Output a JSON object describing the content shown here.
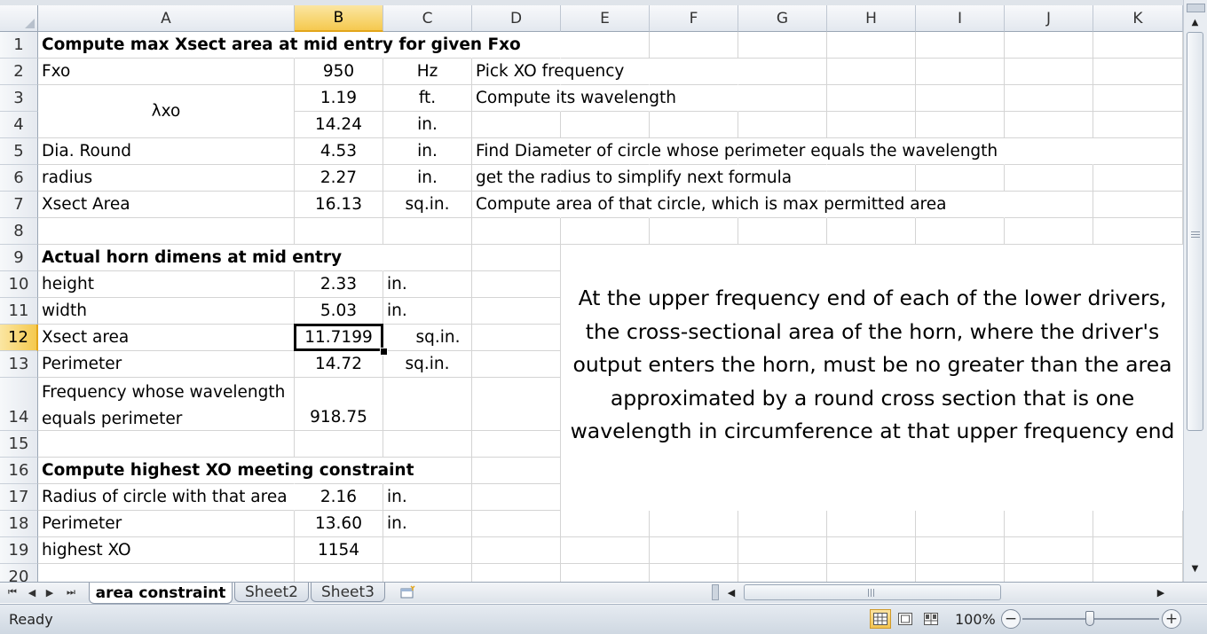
{
  "columns": [
    "A",
    "B",
    "C",
    "D",
    "E",
    "F",
    "G",
    "H",
    "I",
    "J",
    "K"
  ],
  "selected_column": "B",
  "selected_row": "12",
  "rows": [
    "1",
    "2",
    "3",
    "4",
    "5",
    "6",
    "7",
    "8",
    "9",
    "10",
    "11",
    "12",
    "13",
    "14",
    "15",
    "16",
    "17",
    "18",
    "19",
    "20"
  ],
  "cells": {
    "A1": "Compute max Xsect area at mid entry for given Fxo",
    "A2": "Fxo",
    "B2": "950",
    "C2": "Hz",
    "D2": "Pick XO frequency",
    "A3": "λxo",
    "B3": "1.19",
    "C3": "ft.",
    "D3": "Compute its wavelength",
    "B4": "14.24",
    "C4": "in.",
    "A5": "Dia.  Round",
    "B5": "4.53",
    "C5": "in.",
    "D5": "Find Diameter of circle whose perimeter equals the wavelength",
    "A6": "radius",
    "B6": "2.27",
    "C6": "in.",
    "D6": "get the radius to simplify next formula",
    "A7": "Xsect Area",
    "B7": "16.13",
    "C7": "sq.in.",
    "D7": "Compute area of that circle, which is max permitted area",
    "A9": "Actual horn dimens at mid entry",
    "A10": "height",
    "B10": "2.33",
    "C10": "in.",
    "A11": "width",
    "B11": "5.03",
    "C11": "in.",
    "A12": "Xsect area",
    "B12": "11.7199",
    "C12": "sq.in.",
    "A13": "Perimeter",
    "B13": "14.72",
    "C13": "sq.in.",
    "A14_line1": "Frequency whose wavelength",
    "A14_line2": "equals perimeter",
    "B14": "918.75",
    "A16": "Compute highest XO meeting constraint",
    "A17": "Radius of circle with that area",
    "B17": "2.16",
    "C17": "in.",
    "A18": "Perimeter",
    "B18": "13.60",
    "C18": "in.",
    "A19": "highest XO",
    "B19": "1154"
  },
  "textbox": {
    "lines": [
      "At the upper frequency end of each of the lower drivers,",
      "the cross-sectional area of the horn, where the driver's",
      "output enters the horn, must be no greater than the area",
      "approximated by a round cross section that is one",
      "wavelength in circumference at that upper frequency end"
    ]
  },
  "sheet_tabs": [
    {
      "label": "area constraint",
      "active": true
    },
    {
      "label": "Sheet2",
      "active": false
    },
    {
      "label": "Sheet3",
      "active": false
    }
  ],
  "nav_icons": [
    "first-sheet-icon",
    "prev-sheet-icon",
    "next-sheet-icon",
    "last-sheet-icon"
  ],
  "status": {
    "text": "Ready",
    "zoom": "100%",
    "zoom_fraction": 0.5,
    "view": "normal"
  },
  "colors": {
    "selection_header": "#f5c94f",
    "gridline": "#d4d4d4",
    "header_bg": "#e3e8ef"
  }
}
